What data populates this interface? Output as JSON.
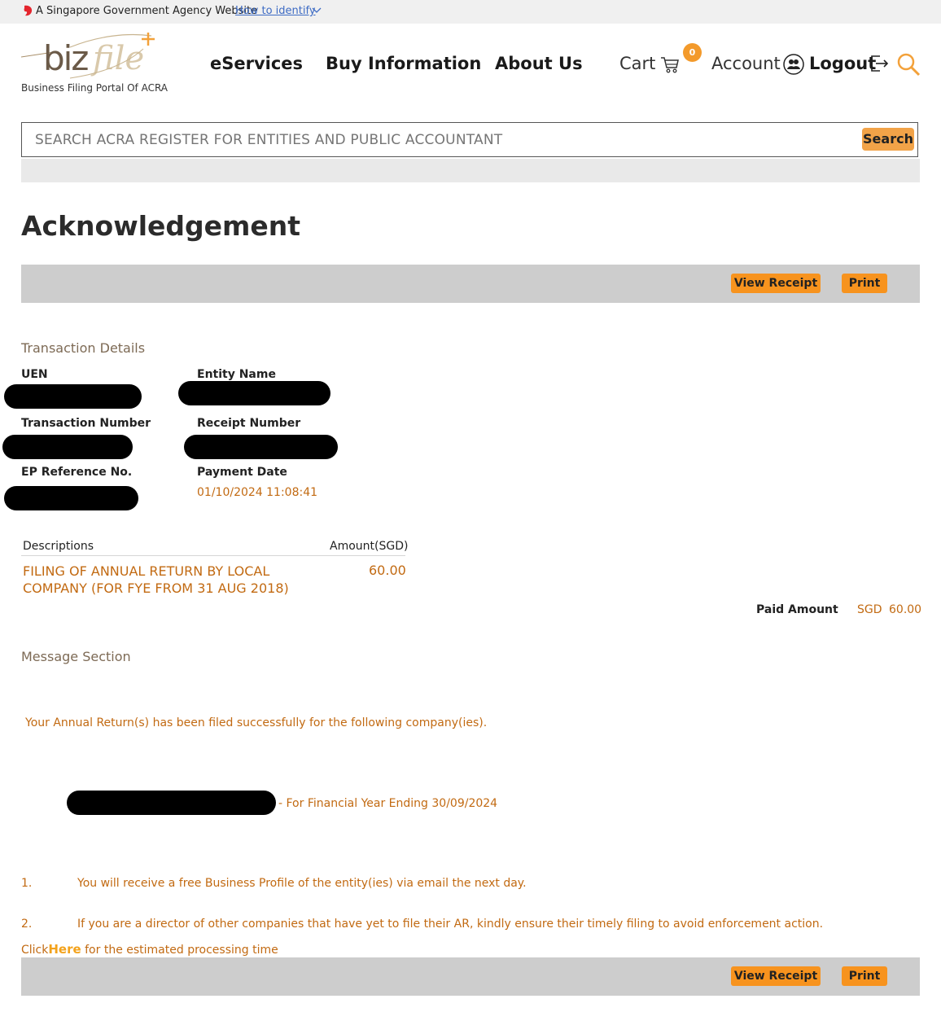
{
  "masthead": {
    "text": "A Singapore Government Agency Website",
    "link": "How to identify"
  },
  "header": {
    "logo_subtitle": "Business Filing Portal Of ACRA",
    "nav": {
      "eservices": "eServices",
      "buy_information": "Buy Information",
      "about_us": "About Us",
      "cart": "Cart",
      "cart_count": "0",
      "account": "Account",
      "logout": "Logout"
    }
  },
  "search": {
    "placeholder": "SEARCH ACRA REGISTER FOR ENTITIES AND PUBLIC ACCOUNTANT",
    "button": "Search"
  },
  "page_title": "Acknowledgement",
  "actions": {
    "view_receipt": "View Receipt",
    "print": "Print"
  },
  "transaction": {
    "section_title": "Transaction Details",
    "uen_label": "UEN",
    "entity_name_label": "Entity Name",
    "transaction_number_label": "Transaction Number",
    "receipt_number_label": "Receipt Number",
    "ep_reference_label": "EP Reference No.",
    "payment_date_label": "Payment Date",
    "payment_date": "01/10/2024 11:08:41"
  },
  "items": {
    "col_description": "Descriptions",
    "col_amount": "Amount(SGD)",
    "rows": [
      {
        "description": "FILING OF ANNUAL RETURN BY LOCAL COMPANY (FOR FYE FROM 31 AUG 2018)",
        "amount": "60.00"
      }
    ],
    "paid_amount_label": "Paid Amount",
    "paid_currency": "SGD",
    "paid_amount": "60.00"
  },
  "message": {
    "section_title": "Message Section",
    "success": "Your Annual Return(s) has been filed successfully for the following company(ies).",
    "fye_suffix": "- For Financial Year Ending 30/09/2024",
    "notes": [
      {
        "num": "1.",
        "text": "You will receive a free Business Profile of the entity(ies) via email the next day."
      },
      {
        "num": "2.",
        "text": "If you are a director of other companies that have yet to file their AR, kindly ensure their timely filing to avoid enforcement action."
      }
    ],
    "click_prefix": "Click",
    "click_link": "Here",
    "click_suffix": "for the estimated processing time"
  },
  "colors": {
    "accent_orange": "#f7931e",
    "text_orange": "#c26a12",
    "action_bar_grey": "#cdcdcd"
  },
  "icons": [
    "lion-head-icon",
    "chevron-down-icon",
    "cart-icon",
    "account-icon",
    "logout-icon",
    "search-icon"
  ]
}
